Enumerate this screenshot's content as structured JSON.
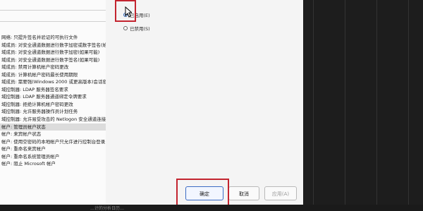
{
  "policy_list": [
    "网络: 只提升签名并验证的可执行文件",
    "域成员: 对安全通道数据进行数字加密或数字签名(始终)",
    "域成员: 对安全通道数据进行数字加密(如果可能)",
    "域成员: 对安全通道数据进行数字签名(如果可能)",
    "域成员: 禁用计算机帐户密码更改",
    "域成员: 计算机帐户密码最长使用期限",
    "域成员: 需要强(Windows 2000 或更高版本)会话密钥",
    "域控制器: LDAP 服务器签名要求",
    "域控制器: LDAP 服务器通道绑定令牌要求",
    "域控制器: 拒绝计算机帐户密码更改",
    "域控制器: 允许服务器操作员计划任务",
    "域控制器: 允许易受攻击的 Netlogon 安全通道连接",
    "帐户: 管理员帐户状态",
    "帐户: 来宾帐户状态",
    "帐户: 使用空密码的本地帐户只允许进行控制台登录",
    "帐户: 重命名来宾帐户",
    "帐户: 重命名系统管理员帐户",
    "帐户: 阻止 Microsoft 帐户"
  ],
  "dialog": {
    "option_enabled": "已启用(E)",
    "option_disabled": "已禁用(S)",
    "ok_button": "确定",
    "cancel_button": "取消",
    "apply_button": "应用(A)"
  },
  "taskbar": {
    "partial_text": "…计的分析日历…"
  },
  "colors": {
    "highlight": "#c3242f",
    "radio_accent": "#2962b4",
    "background_dark": "#1f1f1f"
  }
}
